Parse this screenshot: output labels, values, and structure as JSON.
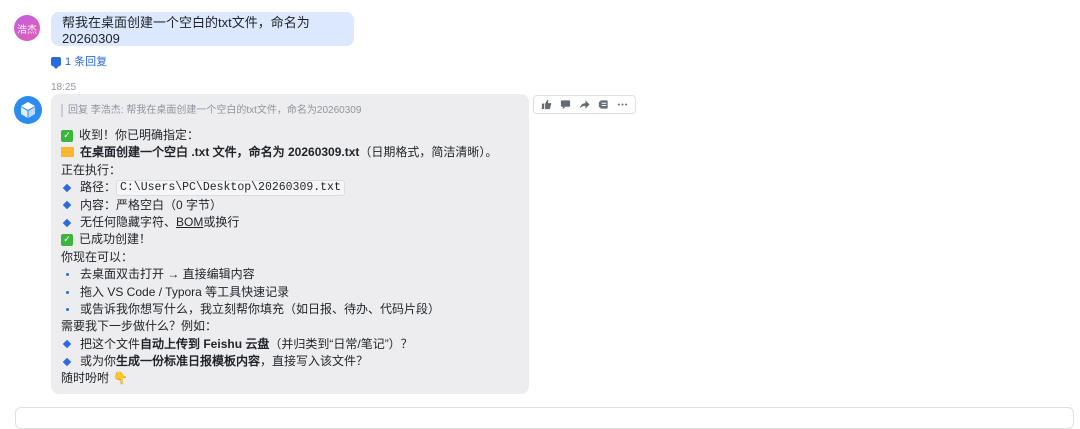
{
  "user": {
    "avatar_text": "浩杰",
    "message": "帮我在桌面创建一个空白的txt文件，命名为20260309"
  },
  "thread": {
    "reply_count_label": "1 条回复",
    "timestamp": "18:25"
  },
  "bot": {
    "quote": "回复 李浩杰: 帮我在桌面创建一个空白的txt文件，命名为20260309",
    "l1": "收到！你已明确指定：",
    "l2_bold": "在桌面创建一个空白 .txt 文件，命名为 20260309.txt",
    "l2_tail": "（日期格式，简洁清晰）。",
    "l3": "正在执行：",
    "l4_label": "路径：",
    "l4_path": "C:\\Users\\PC\\Desktop\\20260309.txt",
    "l5": "内容：严格空白（0 字节）",
    "l6_a": "无任何隐藏字符、",
    "l6_b": "BOM",
    "l6_c": " 或换行",
    "l7": "已成功创建！",
    "l8": "你现在可以：",
    "l9": "去桌面双击打开 → 直接编辑内容",
    "l10": "拖入 VS Code / Typora 等工具快速记录",
    "l11": "或告诉我你想写什么，我立刻帮你填充（如日报、待办、代码片段）",
    "l12": "需要我下一步做什么？例如：",
    "l13_a": "把这个文件",
    "l13_b": "自动上传到 Feishu 云盘",
    "l13_c": "（并归类到“日常/笔记”）？",
    "l14_a": "或为你",
    "l14_b": "生成一份标准日报模板内容",
    "l14_c": "，直接写入该文件？",
    "l15": "随时吩咐",
    "l15_emoji": "👇"
  },
  "actions": [
    "thumbs-up-icon",
    "comment-icon",
    "forward-icon",
    "pin-icon",
    "more-icon"
  ]
}
